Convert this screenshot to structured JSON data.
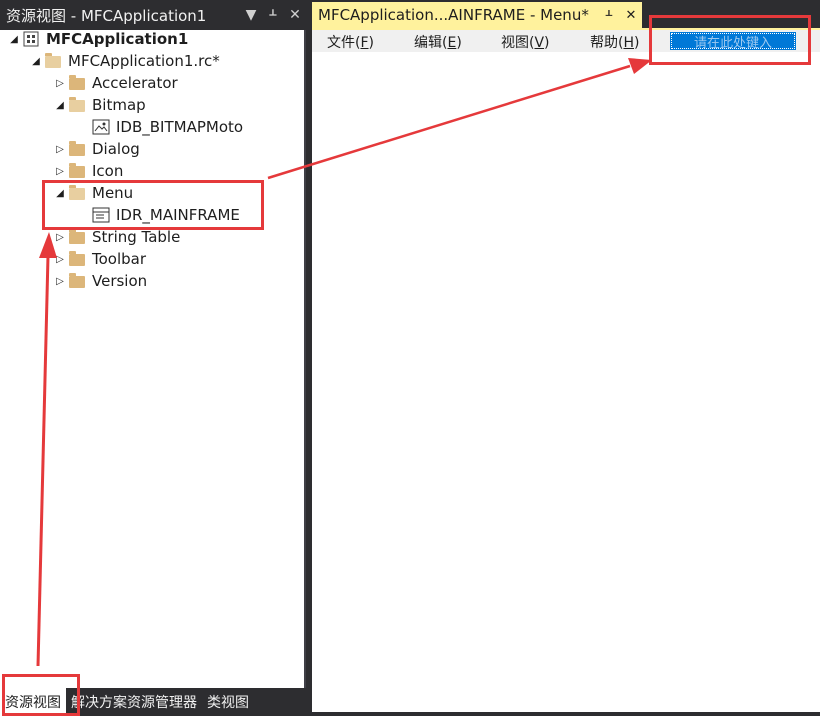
{
  "left_panel": {
    "title": "资源视图 - MFCApplication1",
    "dropdown_glyph": "▼",
    "pin_glyph": "ᚆ",
    "close_glyph": "✕",
    "tree": [
      {
        "label": "MFCApplication1",
        "expanded": true,
        "icon": "project-icon"
      },
      {
        "label": "MFCApplication1.rc*",
        "expanded": true,
        "icon": "folder-open-icon"
      },
      {
        "label": "Accelerator",
        "expanded": false,
        "icon": "folder-icon"
      },
      {
        "label": "Bitmap",
        "expanded": true,
        "icon": "folder-open-icon"
      },
      {
        "label": "IDB_BITMAPMoto",
        "icon": "bitmap-icon"
      },
      {
        "label": "Dialog",
        "expanded": false,
        "icon": "folder-icon"
      },
      {
        "label": "Icon",
        "expanded": false,
        "icon": "folder-icon"
      },
      {
        "label": "Menu",
        "expanded": true,
        "icon": "folder-open-icon"
      },
      {
        "label": "IDR_MAINFRAME",
        "icon": "menu-resource-icon"
      },
      {
        "label": "String Table",
        "expanded": false,
        "icon": "folder-icon"
      },
      {
        "label": "Toolbar",
        "expanded": false,
        "icon": "folder-icon"
      },
      {
        "label": "Version",
        "expanded": false,
        "icon": "folder-icon"
      }
    ],
    "bottom_tabs": [
      "资源视图",
      "解决方案资源管理器",
      "类视图"
    ]
  },
  "document": {
    "tab_title": "MFCApplication...AINFRAME - Menu*",
    "pin_glyph": "ᚆ",
    "close_glyph": "✕",
    "menu_items": [
      {
        "text": "文件(",
        "key": "F",
        "end": ")"
      },
      {
        "text": "编辑(",
        "key": "E",
        "end": ")"
      },
      {
        "text": "视图(",
        "key": "V",
        "end": ")"
      },
      {
        "text": "帮助(",
        "key": "H",
        "end": ")"
      }
    ],
    "type_here_placeholder": "请在此处键入"
  },
  "colors": {
    "annotation_red": "#e5393b",
    "selection_blue": "#0078d7",
    "doc_tab_yellow": "#fff29d",
    "folder": "#dcb67a"
  }
}
